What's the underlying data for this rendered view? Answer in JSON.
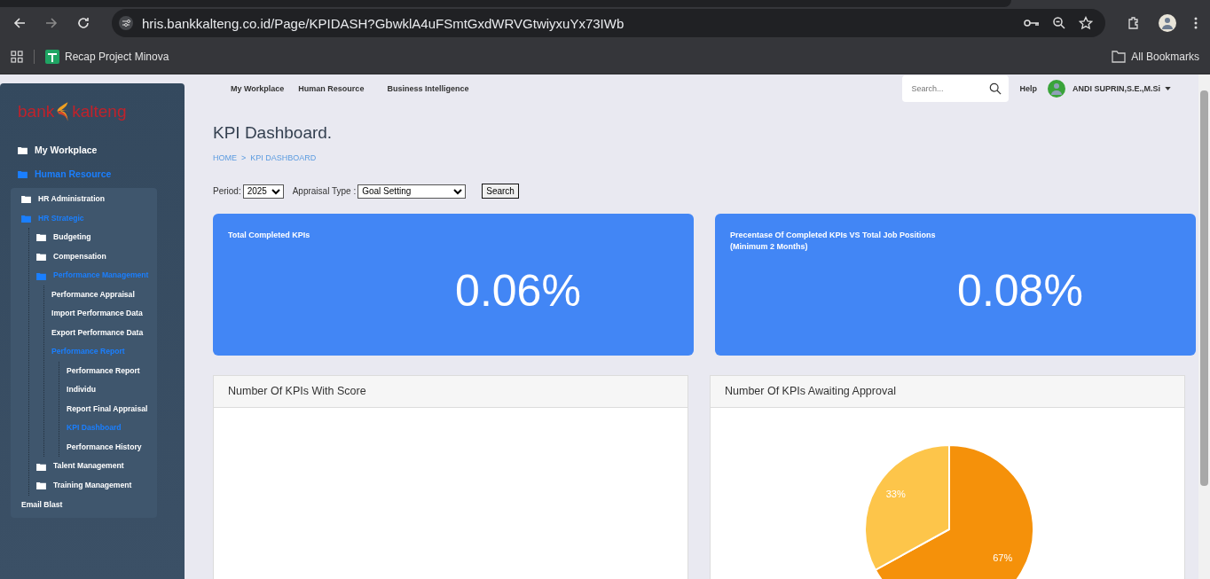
{
  "browser": {
    "url": "hris.bankkalteng.co.id/Page/KPIDASH?GbwklA4uFSmtGxdWRVGtwiyxuYx73IWb",
    "bookmarks": [
      {
        "label": "Recap Project Minova"
      }
    ],
    "all_bookmarks": "All Bookmarks"
  },
  "logo": {
    "left": "bank",
    "right": "kalteng"
  },
  "sidebar": {
    "items": [
      {
        "label": "My Workplace",
        "kind": "folder",
        "active": false
      },
      {
        "label": "Human Resource",
        "kind": "folder",
        "active": true,
        "children": [
          {
            "label": "HR Administration",
            "kind": "folder",
            "active": false
          },
          {
            "label": "HR Strategic",
            "kind": "folder",
            "active": true,
            "children": [
              {
                "label": "Budgeting",
                "kind": "folder",
                "active": false
              },
              {
                "label": "Compensation",
                "kind": "folder",
                "active": false
              },
              {
                "label": "Performance Management",
                "kind": "folder",
                "active": true,
                "children": [
                  {
                    "label": "Performance Appraisal",
                    "kind": "link",
                    "active": false
                  },
                  {
                    "label": "Import Performance Data",
                    "kind": "link",
                    "active": false
                  },
                  {
                    "label": "Export Performance Data",
                    "kind": "link",
                    "active": false
                  },
                  {
                    "label": "Performance Report",
                    "kind": "link",
                    "active": true,
                    "children": [
                      {
                        "label": "Performance Report",
                        "kind": "link",
                        "active": false
                      },
                      {
                        "label": "Individu",
                        "kind": "link",
                        "active": false
                      },
                      {
                        "label": "Report Final Appraisal",
                        "kind": "link",
                        "active": false
                      },
                      {
                        "label": "KPI Dashboard",
                        "kind": "link",
                        "active": true
                      },
                      {
                        "label": "Performance History",
                        "kind": "link",
                        "active": false
                      }
                    ]
                  }
                ]
              },
              {
                "label": "Talent Management",
                "kind": "folder",
                "active": false
              },
              {
                "label": "Training Management",
                "kind": "folder",
                "active": false
              }
            ]
          },
          {
            "label": "Email Blast",
            "kind": "link",
            "active": false
          }
        ]
      }
    ]
  },
  "top_nav": [
    {
      "label": "My Workplace"
    },
    {
      "label": "Human Resource"
    },
    {
      "label": "Business Intelligence"
    }
  ],
  "search": {
    "placeholder": "Search..."
  },
  "help": "Help",
  "user": {
    "name": "ANDI SUPRIN,S.E.,M.Si"
  },
  "page": {
    "title": "KPI Dashboard.",
    "breadcrumb": [
      "HOME",
      "KPI DASHBOARD"
    ],
    "breadcrumb_separator": ">"
  },
  "filters": {
    "period_label": "Period:",
    "period": "2025",
    "type_label": "Appraisal Type :",
    "type": "Goal Setting",
    "button": "Search"
  },
  "stats": [
    {
      "title": "Total Completed KPIs",
      "value": "0.06%"
    },
    {
      "title": "Precentase Of Completed KPIs VS Total Job Positions",
      "subtitle": "(Minimum 2 Months)",
      "value": "0.08%"
    }
  ],
  "panels": [
    {
      "title": "Number Of KPIs With Score"
    },
    {
      "title": "Number Of KPIs Awaiting Approval",
      "chart_data": {
        "type": "pie",
        "values": [
          67,
          33
        ],
        "data_labels": true,
        "value_labels": [
          "67%",
          "33%"
        ]
      }
    }
  ]
}
